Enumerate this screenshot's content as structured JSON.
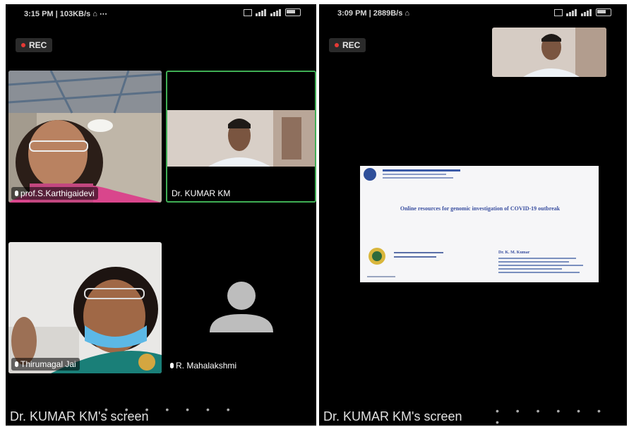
{
  "left": {
    "status": {
      "time": "3:15 PM | 103KB/s ⌂ ⋯"
    },
    "rec_label": "REC",
    "participants": [
      {
        "name": "prof.S.Karthigaidevi",
        "muted": true
      },
      {
        "name": "Dr. KUMAR KM",
        "active_speaker": true
      },
      {
        "name": "Thirumagal Jai",
        "muted": true
      },
      {
        "name": "R. Mahalakshmi",
        "muted": true,
        "video_off": true
      }
    ],
    "footer": "Dr. KUMAR KM's screen"
  },
  "right": {
    "status": {
      "time": "3:09 PM | 2889B/s ⌂"
    },
    "rec_label": "REC",
    "slide": {
      "title": "Online resources for genomic investigation of COVID-19 outbreak",
      "presenter": "Dr. K. M. Kumar"
    },
    "footer": "Dr. KUMAR KM's screen"
  },
  "colors": {
    "active_border": "#3fae54",
    "background": "#000000",
    "rec_dot": "#e53935"
  }
}
